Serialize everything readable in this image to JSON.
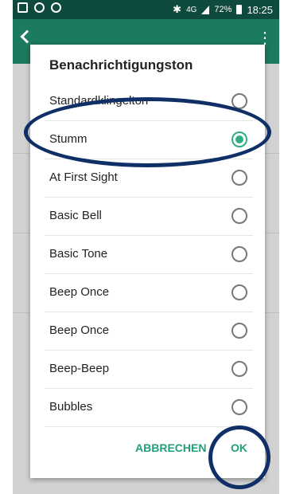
{
  "statusbar": {
    "bluetooth": "✱",
    "network": "4G",
    "battery": "72%",
    "time": "18:25",
    "icons": [
      "gallery-icon",
      "missed-call-icon",
      "data-saver-icon"
    ]
  },
  "appbar": {
    "more": "⋮"
  },
  "dialog": {
    "title": "Benachrichtigungston",
    "options": [
      {
        "label": "Standardklingelton",
        "checked": false
      },
      {
        "label": "Stumm",
        "checked": true
      },
      {
        "label": "At First Sight",
        "checked": false
      },
      {
        "label": "Basic Bell",
        "checked": false
      },
      {
        "label": "Basic Tone",
        "checked": false
      },
      {
        "label": "Beep Once",
        "checked": false
      },
      {
        "label": "Beep Once",
        "checked": false
      },
      {
        "label": "Beep-Beep",
        "checked": false
      },
      {
        "label": "Bubbles",
        "checked": false
      }
    ],
    "cancel_label": "ABBRECHEN",
    "ok_label": "OK"
  },
  "colors": {
    "accent": "#2fae84",
    "annotation": "#0f2f66",
    "appbar": "#1c7a5e"
  }
}
